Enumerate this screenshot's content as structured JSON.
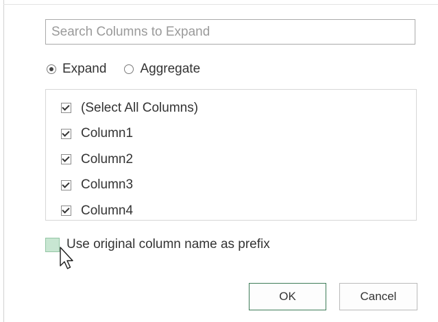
{
  "search": {
    "value": "",
    "placeholder": "Search Columns to Expand"
  },
  "mode": {
    "options": [
      {
        "label": "Expand",
        "selected": true
      },
      {
        "label": "Aggregate",
        "selected": false
      }
    ]
  },
  "columns": [
    {
      "label": "(Select All Columns)",
      "checked": true
    },
    {
      "label": "Column1",
      "checked": true
    },
    {
      "label": "Column2",
      "checked": true
    },
    {
      "label": "Column3",
      "checked": true
    },
    {
      "label": "Column4",
      "checked": true
    }
  ],
  "prefix": {
    "label": "Use original column name as prefix",
    "checked": false
  },
  "buttons": {
    "ok_label": "OK",
    "cancel_label": "Cancel"
  },
  "colors": {
    "ok_border": "#3c7a56",
    "prefix_hover_fill": "#c8e6d2"
  }
}
